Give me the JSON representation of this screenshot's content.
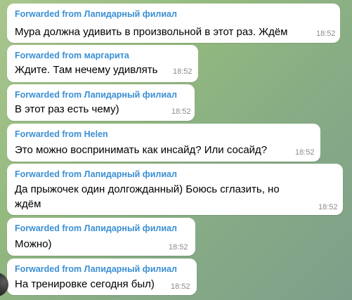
{
  "messages": [
    {
      "forwarded_from": "Forwarded from Лапидарный филиал",
      "text": "Мура должна удивить в произвольной в этот раз. Ждём",
      "time": "18:52"
    },
    {
      "forwarded_from": "Forwarded from маргарита",
      "text": "Ждите. Там нечему удивлять",
      "time": "18:52"
    },
    {
      "forwarded_from": "Forwarded from Лапидарный филиал",
      "text": "В этот раз есть чему)",
      "time": "18:52"
    },
    {
      "forwarded_from": "Forwarded from Helen",
      "text": "Это можно воспринимать как инсайд? Или сосайд?",
      "time": "18:52"
    },
    {
      "forwarded_from": "Forwarded from Лапидарный филиал",
      "text_line1": "Да прыжочек один долгожданный) Боюсь сглазить, но",
      "text_line2": "ждём",
      "time": "18:52"
    },
    {
      "forwarded_from": "Forwarded from Лапидарный филиал",
      "text": "Можно)",
      "time": "18:52"
    },
    {
      "forwarded_from": "Forwarded from Лапидарный филиал",
      "text": "На тренировке сегодня был)",
      "time": "18:52"
    }
  ]
}
